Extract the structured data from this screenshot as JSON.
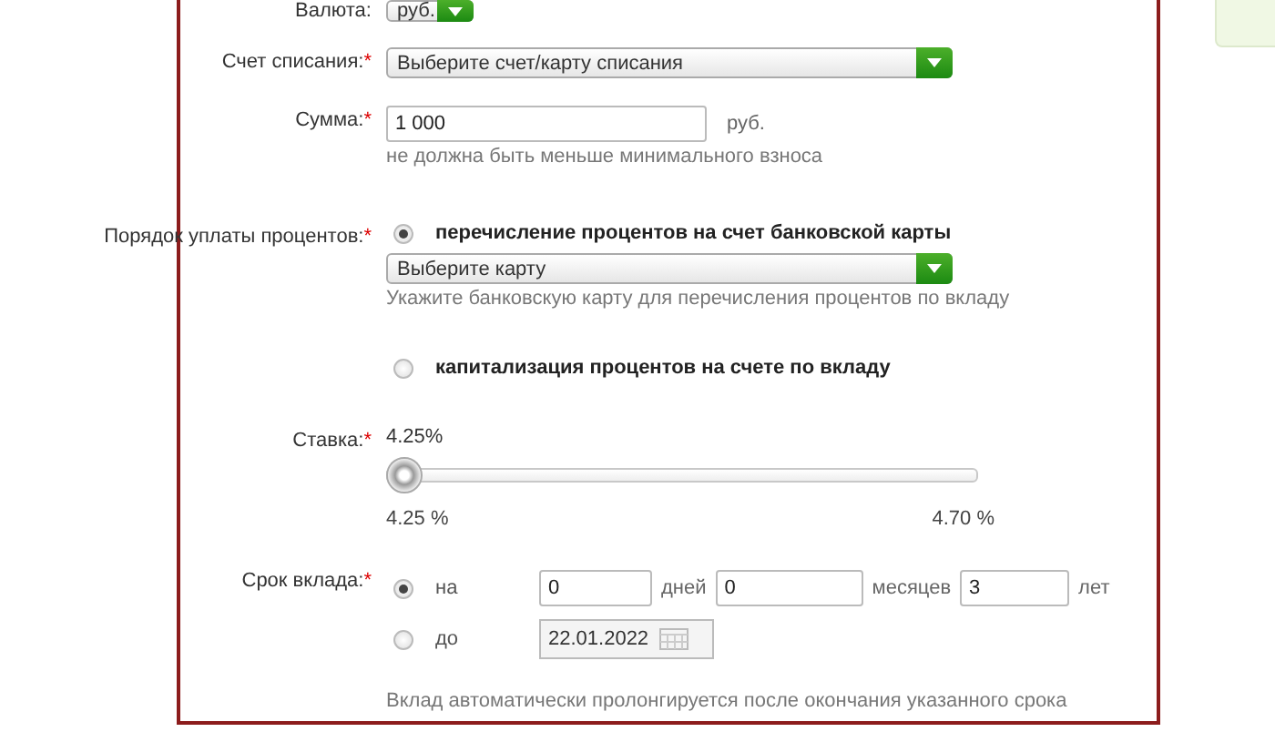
{
  "currency": {
    "label": "Валюта:",
    "value": "руб."
  },
  "account": {
    "label": "Счет списания:",
    "required_mark": "*",
    "value": "Выберите счет/карту списания"
  },
  "amount": {
    "label": "Сумма:",
    "required_mark": "*",
    "value": "1 000",
    "unit": "руб.",
    "hint": "не должна быть меньше минимального взноса"
  },
  "interest": {
    "label": "Порядок уплаты процентов:",
    "required_mark": "*",
    "options": [
      {
        "label": "перечисление процентов на счет банковской карты",
        "selected": true,
        "select": {
          "value": "Выберите карту",
          "hint": "Укажите банковскую карту для перечисления процентов по вкладу"
        }
      },
      {
        "label": "капитализация процентов на счете по вкладу",
        "selected": false
      }
    ]
  },
  "rate": {
    "label": "Ставка:",
    "required_mark": "*",
    "value": "4.25%",
    "level": 0,
    "min": "4.25 %",
    "max": "4.70 %"
  },
  "term": {
    "label": "Срок вклада:",
    "required_mark": "*",
    "options": [
      {
        "kind": "duration",
        "label": "на",
        "selected": true,
        "fields": [
          {
            "value": "0",
            "unit": "дней"
          },
          {
            "value": "0",
            "unit": "месяцев"
          },
          {
            "value": "3",
            "unit": "лет"
          }
        ]
      },
      {
        "kind": "date",
        "label": "до",
        "selected": false,
        "value": "22.01.2022"
      }
    ],
    "note": "Вклад автоматически пролонгируется после окончания указанного срока"
  }
}
